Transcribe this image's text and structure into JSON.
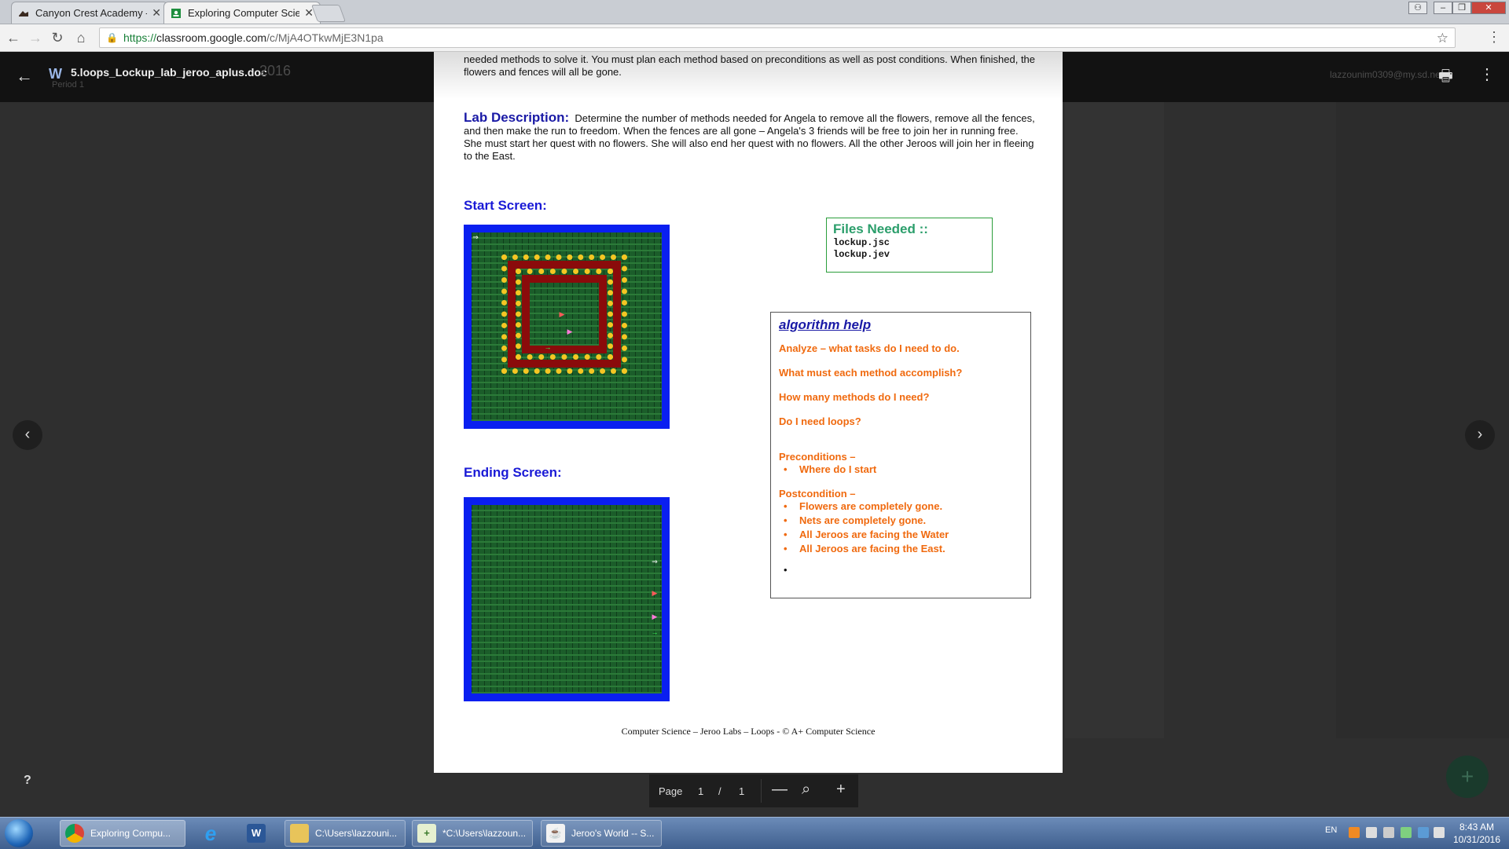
{
  "browser": {
    "tabs": [
      {
        "title": "Canyon Crest Academy -",
        "active": false
      },
      {
        "title": "Exploring Computer Scie",
        "active": true
      }
    ],
    "url_scheme": "https://",
    "url_host": "classroom.google.com",
    "url_path": "/c/MjA4OTkwMjE3N1pa"
  },
  "viewer": {
    "doc_name": "5.loops_Lockup_lab_jeroo_aplus.doc",
    "ghost_title": "2016",
    "period": "Period 1",
    "user_email": "lazzounim0309@my.sd.net"
  },
  "document": {
    "intro": "needed methods to solve it. You must plan each method based on preconditions as well as post conditions. When finished, the flowers and fences will all be gone.",
    "lab_label": "Lab Description:",
    "lab_text": "Determine the number of methods needed for Angela to remove all the flowers, remove all the fences, and then make the run to freedom. When the fences are all gone – Angela's 3 friends will be free to join her in running free. She must start her quest with no flowers. She will also end her quest with no flowers. All the other Jeroos will join her in fleeing to the East.",
    "start_screen": "Start Screen:",
    "ending_screen": "Ending Screen:",
    "files_title": "Files Needed ::",
    "files": [
      "lockup.jsc",
      "lockup.jev"
    ],
    "algo_title": "algorithm help",
    "algo_questions": [
      "Analyze – what tasks do I need to do.",
      "What must each method accomplish?",
      "How many methods do I need?",
      "Do I need loops?"
    ],
    "preconditions_label": "Preconditions –",
    "preconditions": [
      "Where do I start"
    ],
    "postcondition_label": "Postcondition –",
    "postconditions": [
      "Flowers are completely gone.",
      "Nets are completely gone.",
      "All Jeroos are facing the Water",
      "All Jeroos are facing the East."
    ],
    "footer": "Computer Science – Jeroo Labs –  Loops - © A+ Computer Science"
  },
  "pager": {
    "label": "Page",
    "current": "1",
    "sep": "/",
    "total": "1"
  },
  "taskbar": {
    "items": [
      {
        "label": "Exploring Compu...",
        "active": true
      },
      {
        "label": "C:\\Users\\lazzouni...",
        "active": false
      },
      {
        "label": "*C:\\Users\\lazzoun...",
        "active": false
      },
      {
        "label": "Jeroo's World -- S...",
        "active": false
      }
    ],
    "lang": "EN",
    "time": "8:43 AM",
    "date": "10/31/2016"
  }
}
